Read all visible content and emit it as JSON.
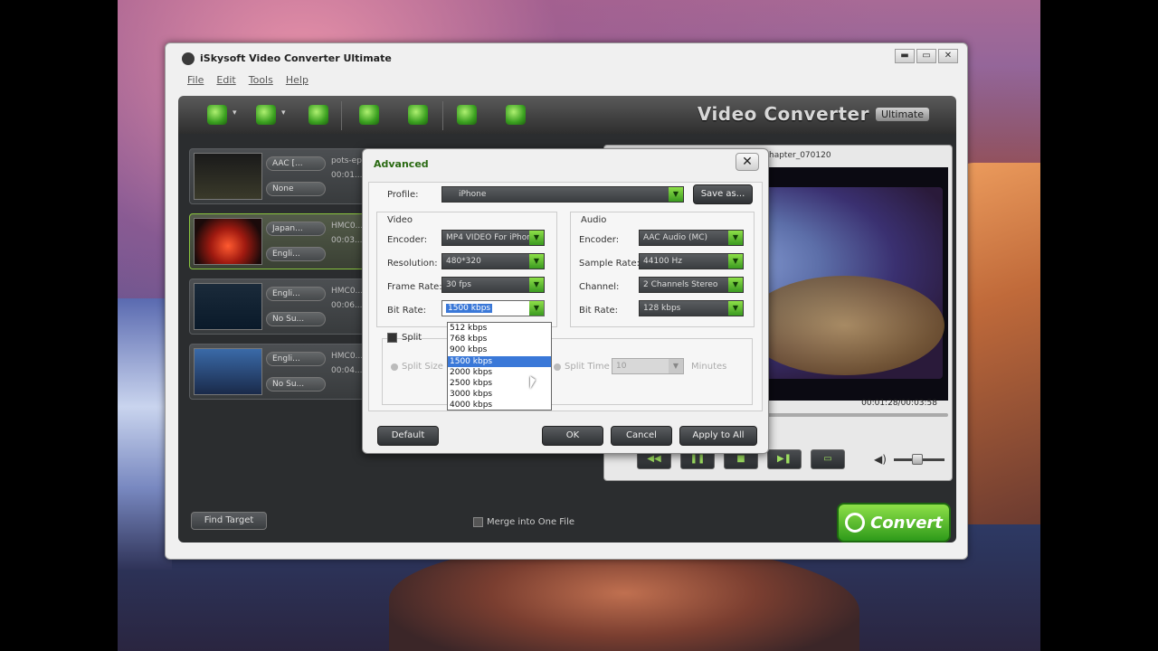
{
  "app": {
    "title": "iSkysoft Video Converter Ultimate",
    "window_controls": [
      "▬",
      "▭",
      "✕"
    ],
    "menu": [
      "File",
      "Edit",
      "Tools",
      "Help"
    ],
    "brand": "Video Converter",
    "brand_badge": "Ultimate",
    "toolbar_icons": [
      "add-video-icon",
      "add-dvd-icon",
      "download-icon",
      "cut-icon",
      "edit-icon",
      "export-icon",
      "rotate-icon"
    ]
  },
  "files": [
    {
      "audio": "AAC [...",
      "subtitle": "None",
      "name": "pots-ep...",
      "duration": "00:01..."
    },
    {
      "audio": "Japan...",
      "subtitle": "Engli...",
      "name": "HMC0...",
      "duration": "00:03..."
    },
    {
      "audio": "Engli...",
      "subtitle": "No Su...",
      "name": "HMC0...",
      "duration": "00:06..."
    },
    {
      "audio": "Engli...",
      "subtitle": "No Su...",
      "name": "HMC0...",
      "duration": "00:04..."
    }
  ],
  "find_target": "Find Target",
  "merge_label": "Merge into One File",
  "preview": {
    "title": "hapter_070120",
    "timecode": "00:01:28/00:03:58",
    "controls": [
      "◀◀",
      "❚❚",
      "■",
      "▶❚",
      "▭"
    ],
    "volume_icon": "◀)"
  },
  "convert_label": "Convert",
  "advanced": {
    "title": "Advanced",
    "close": "✕",
    "profile_label": "Profile:",
    "profile_value": "iPhone",
    "save_as": "Save as...",
    "video": {
      "heading": "Video",
      "encoder_label": "Encoder:",
      "encoder_value": "MP4 VIDEO For iPhone",
      "resolution_label": "Resolution:",
      "resolution_value": "480*320",
      "framerate_label": "Frame Rate:",
      "framerate_value": "30 fps",
      "bitrate_label": "Bit Rate:",
      "bitrate_value": "1500 kbps"
    },
    "audio": {
      "heading": "Audio",
      "encoder_label": "Encoder:",
      "encoder_value": "AAC Audio (MC)",
      "samplerate_label": "Sample Rate:",
      "samplerate_value": "44100 Hz",
      "channel_label": "Channel:",
      "channel_value": "2 Channels Stereo",
      "bitrate_label": "Bit Rate:",
      "bitrate_value": "128 kbps"
    },
    "split_label": "Split",
    "split_size_label": "Split Size",
    "split_time_label": "Split Time",
    "split_time_value": "10",
    "minutes_label": "Minutes",
    "bitrate_options": [
      "512 kbps",
      "768 kbps",
      "900 kbps",
      "1500 kbps",
      "2000 kbps",
      "2500 kbps",
      "3000 kbps",
      "4000 kbps"
    ],
    "bitrate_selected_index": 3,
    "buttons": {
      "default": "Default",
      "ok": "OK",
      "cancel": "Cancel",
      "apply_all": "Apply to All"
    }
  }
}
